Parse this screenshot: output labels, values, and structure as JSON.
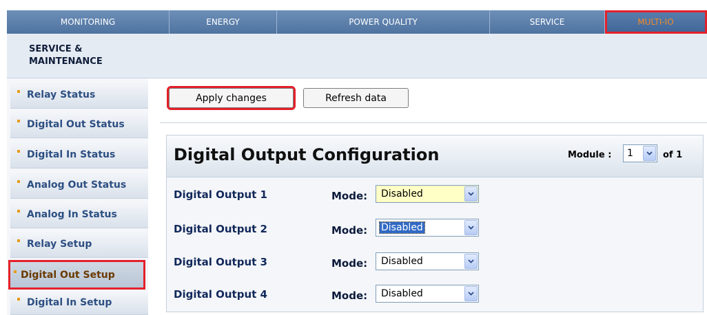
{
  "nav": {
    "tabs": [
      {
        "label": "MONITORING"
      },
      {
        "label": "ENERGY"
      },
      {
        "label": "POWER QUALITY"
      },
      {
        "label": "SERVICE"
      },
      {
        "label": "MULTI-IO"
      }
    ],
    "active": "MULTI-IO"
  },
  "header": {
    "title": "SERVICE & MAINTENANCE"
  },
  "sidebar": {
    "items": [
      {
        "label": "Relay Status"
      },
      {
        "label": "Digital Out Status"
      },
      {
        "label": "Digital In Status"
      },
      {
        "label": "Analog Out Status"
      },
      {
        "label": "Analog In Status"
      },
      {
        "label": "Relay Setup"
      },
      {
        "label": "Digital Out Setup"
      },
      {
        "label": "Digital In Setup"
      }
    ],
    "active": "Digital Out Setup"
  },
  "toolbar": {
    "apply_label": "Apply changes",
    "refresh_label": "Refresh data"
  },
  "panel": {
    "title": "Digital Output Configuration",
    "module_label": "Module :",
    "module_value": "1",
    "of_label": "of 1",
    "mode_label": "Mode:",
    "outputs": [
      {
        "label": "Digital Output 1",
        "mode": "Disabled"
      },
      {
        "label": "Digital Output 2",
        "mode": "Disabled"
      },
      {
        "label": "Digital Output 3",
        "mode": "Disabled"
      },
      {
        "label": "Digital Output 4",
        "mode": "Disabled"
      }
    ]
  },
  "colors": {
    "accent": "#4f73a0",
    "active_tab_text": "#f08a2a",
    "highlight_border": "#e4202a",
    "select_focus": "#316ac5"
  }
}
